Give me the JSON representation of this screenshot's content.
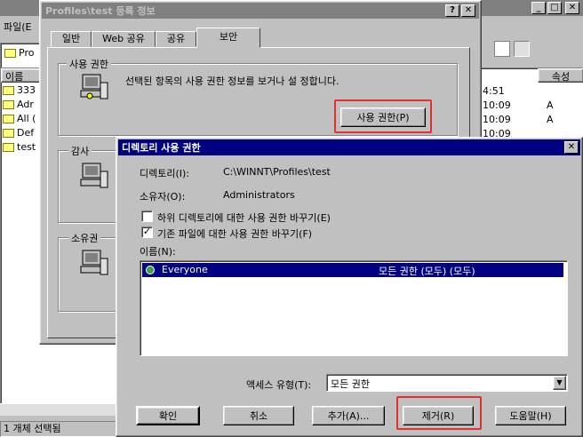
{
  "explorer": {
    "menu_file": "파일(E",
    "column_name": "이름",
    "column_modified": "속성",
    "tree_top": "Pro",
    "files": [
      {
        "name": "333",
        "time": "4:51"
      },
      {
        "name": "Adr",
        "time": "10:09"
      },
      {
        "name": "All (",
        "time": "10:09"
      },
      {
        "name": "Def",
        "time": "10:09"
      },
      {
        "name": "test",
        "time": ""
      }
    ],
    "attr_flag": "A",
    "status_text": "1 개체 선택됨"
  },
  "properties": {
    "title": "Profiles\\test 등록 정보",
    "help_btn": "?",
    "close_btn": "✕",
    "tabs": [
      "일반",
      "Web 공유",
      "공유",
      "보안"
    ],
    "perm_group": "사용 권한",
    "perm_text": "선택된 항목의 사용 권한 정보를 보거나 설 정합니다.",
    "perm_button": "사용 권한(P)",
    "audit_group": "감사",
    "owner_group": "소유권"
  },
  "dialog": {
    "title": "디렉토리 사용 권한",
    "dir_label": "디렉토리(I):",
    "dir_value": "C:\\WINNT\\Profiles\\test",
    "owner_label": "소유자(O):",
    "owner_value": "Administrators",
    "chk_subdir_label": "하위 디렉토리에 대한 사용 권한 바꾸기(E)",
    "chk_subdir_checked": false,
    "chk_files_label": "기존 파일에 대한 사용 권한 바꾸기(F)",
    "chk_files_checked": true,
    "name_label": "이름(N):",
    "entries": [
      {
        "name": "Everyone",
        "perm": "모든 권한 (모두) (모두)"
      }
    ],
    "access_label": "액세스 유형(T):",
    "access_value": "모든 권한",
    "btn_ok": "확인",
    "btn_cancel": "취소",
    "btn_add": "추가(A)...",
    "btn_remove": "제거(R)",
    "btn_help": "도움말(H)",
    "check_mark": "✓"
  },
  "colors": {
    "title_active": "#000080",
    "highlight": "#000080",
    "annotation_red": "#e03030"
  }
}
